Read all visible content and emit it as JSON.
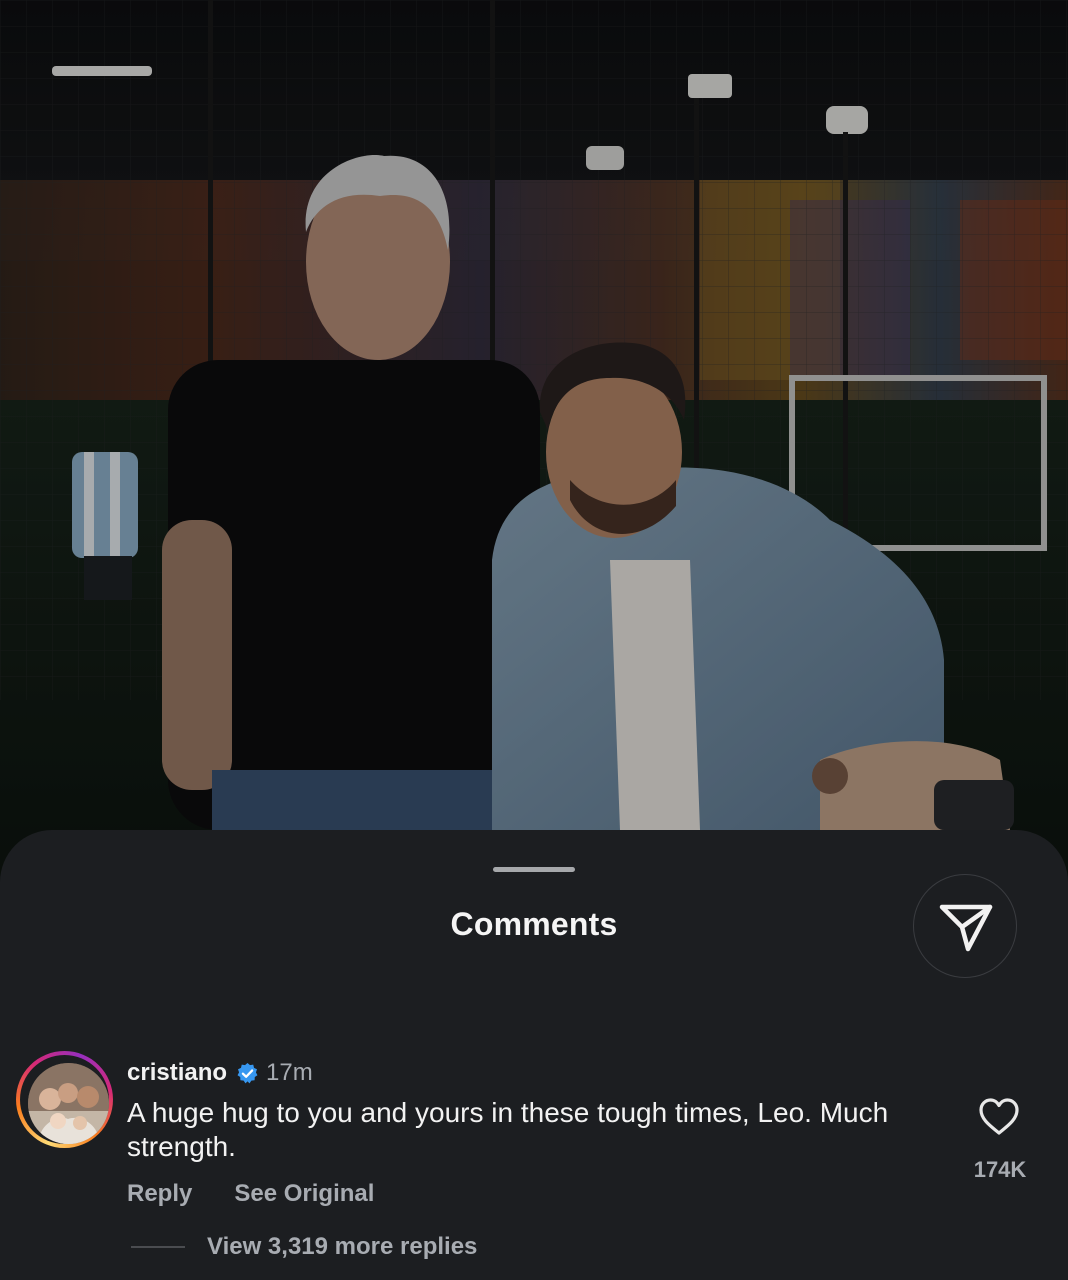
{
  "sheet": {
    "title": "Comments",
    "share_icon": "send-icon"
  },
  "comment": {
    "username": "cristiano",
    "verified_icon": "verified-badge-icon",
    "time": "17m",
    "text": "A huge hug to you and yours in these tough times, Leo. Much strength.",
    "reply_label": "Reply",
    "see_original_label": "See Original",
    "like_icon": "heart-icon",
    "like_count": "174K",
    "view_replies_label": "View 3,319 more replies"
  },
  "colors": {
    "sheet_bg": "#1c1e21",
    "text_primary": "#f2f2f2",
    "text_secondary": "#a8acb2",
    "verified_blue": "#3797f0"
  }
}
